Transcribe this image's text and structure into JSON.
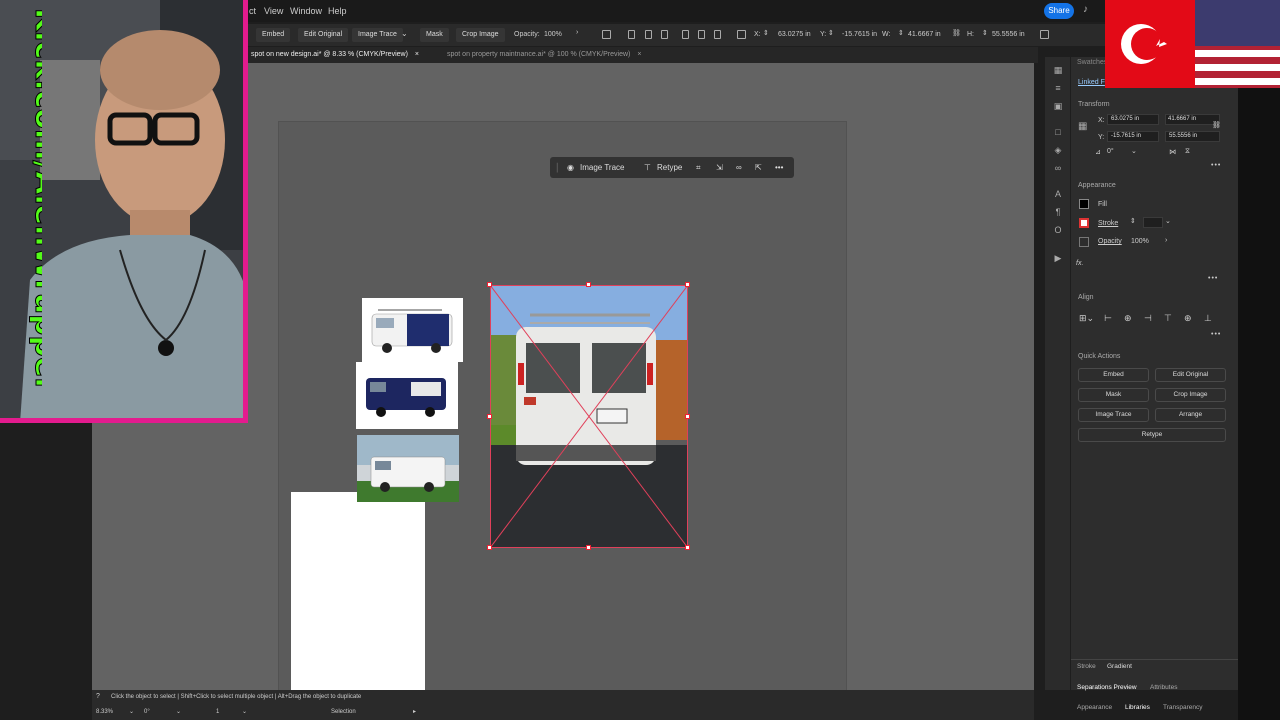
{
  "menu": {
    "items": [
      "ct",
      "View",
      "Window",
      "Help"
    ],
    "share_label": "Share"
  },
  "control_bar": {
    "embed": "Embed",
    "edit_original": "Edit Original",
    "image_trace": "Image Trace",
    "mask": "Mask",
    "crop_image": "Crop Image",
    "opacity_label": "Opacity:",
    "opacity_value": "100%",
    "x_label": "X:",
    "x_value": "63.0275 in",
    "y_label": "Y:",
    "y_value": "-15.7615 in",
    "w_label": "W:",
    "w_value": "41.6667 in",
    "h_label": "H:",
    "h_value": "55.5556 in"
  },
  "tabs": [
    {
      "label": "spot on new design.ai* @ 8.33 % (CMYK/Preview)",
      "close": "×"
    },
    {
      "label": "spot on property maintnance.ai* @ 100 % (CMYK/Preview)",
      "close": "×"
    }
  ],
  "task_bar": {
    "image_trace": "Image Trace",
    "retype": "Retype",
    "more": "•••"
  },
  "panel": {
    "swatches_tab": "Swatches",
    "linked_file": "Linked F",
    "transform_head": "Transform",
    "x_label": "X:",
    "x_value": "63.0275 in",
    "y_label": "Y:",
    "y_value": "-15.7615 in",
    "w_label": "W:",
    "w_value": "41.6667 in",
    "h_label": "H:",
    "h_value": "55.5556 in",
    "angle_value": "0°",
    "appearance_head": "Appearance",
    "fill_label": "Fill",
    "stroke_label": "Stroke",
    "opacity_label": "Opacity",
    "opacity_value": "100%",
    "fx_label": "fx.",
    "align_head": "Align",
    "quick_actions_head": "Quick Actions",
    "qa": {
      "embed": "Embed",
      "edit_original": "Edit Original",
      "mask": "Mask",
      "crop_image": "Crop Image",
      "image_trace": "Image Trace",
      "arrange": "Arrange",
      "retype": "Retype"
    },
    "bottom_tabs": {
      "stroke": "Stroke",
      "gradient": "Gradient",
      "separations": "Separations Preview",
      "attributes": "Attributes",
      "appearance": "Appearance",
      "libraries": "Libraries",
      "transparency": "Transparency"
    }
  },
  "status": {
    "hint": "Click the object to select  |  Shift+Click to select multiple object  |  Alt+Drag the object to duplicate",
    "zoom": "8.33%",
    "rotation": "0°",
    "artboard": "1",
    "tool": "Selection"
  },
  "overlay": {
    "kick_text": "Kick.com/AlenWrapper"
  }
}
